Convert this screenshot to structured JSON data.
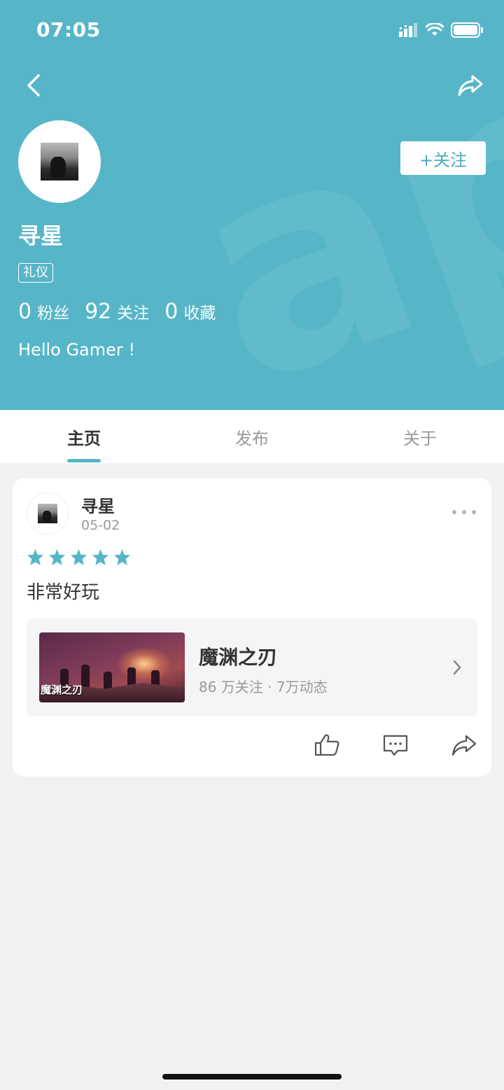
{
  "status_bar": {
    "time": "07:05"
  },
  "profile": {
    "username": "寻星",
    "tag": "礼仪",
    "follow_label": "+关注",
    "stats": [
      {
        "num": "0",
        "label": "粉丝"
      },
      {
        "num": "92",
        "label": "关注"
      },
      {
        "num": "0",
        "label": "收藏"
      }
    ],
    "bio": "Hello Gamer !"
  },
  "tabs": [
    {
      "label": "主页",
      "active": true
    },
    {
      "label": "发布",
      "active": false
    },
    {
      "label": "关于",
      "active": false
    }
  ],
  "post": {
    "author": "寻星",
    "date": "05-02",
    "rating": 5,
    "text": "非常好玩",
    "game": {
      "name": "魔渊之刃",
      "meta": "86 万关注 · 7万动态",
      "thumb_title": "魔渊之刃"
    }
  },
  "colors": {
    "accent": "#56b6c8",
    "follow_text": "#4aacbf"
  },
  "icons": [
    "back-icon",
    "share-icon",
    "more-icon",
    "star-icon",
    "chevron-right-icon",
    "like-icon",
    "comment-icon",
    "share-icon"
  ]
}
